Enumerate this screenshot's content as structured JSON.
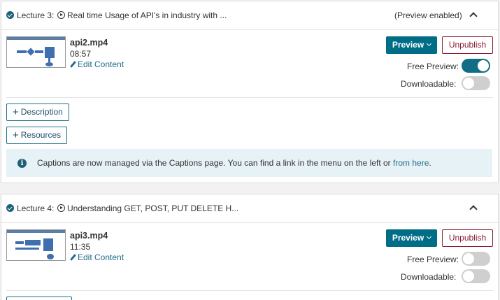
{
  "lectures": [
    {
      "label": "Lecture 3:",
      "title": "Real time Usage of API's in industry with ...",
      "status": "(Preview enabled)",
      "file": "api2.mp4",
      "duration": "08:57",
      "edit_label": "Edit Content",
      "preview_label": "Preview",
      "unpublish_label": "Unpublish",
      "free_preview_label": "Free Preview:",
      "free_preview_on": true,
      "downloadable_label": "Downloadable:",
      "downloadable_on": false,
      "description_label": "Description",
      "resources_label": "Resources",
      "info_text": "Captions are now managed via the Captions page. You can find a link in the menu on the left or ",
      "info_link": "from here",
      "info_end": "."
    },
    {
      "label": "Lecture 4:",
      "title": "Understanding GET, POST, PUT DELETE H...",
      "status": "",
      "file": "api3.mp4",
      "duration": "11:35",
      "edit_label": "Edit Content",
      "preview_label": "Preview",
      "unpublish_label": "Unpublish",
      "free_preview_label": "Free Preview:",
      "free_preview_on": false,
      "downloadable_label": "Downloadable:",
      "downloadable_on": false
    }
  ],
  "icons": {
    "check": "check-circle-icon",
    "play": "play-circle-icon",
    "chevron": "chevron-up-icon",
    "pencil": "pencil-icon",
    "plus": "plus-icon",
    "info": "info-icon",
    "caret": "caret-down-icon"
  },
  "colors": {
    "primary": "#006d86",
    "danger": "#8b1e36",
    "info_bg": "#e7f2f6",
    "toggle_on": "#0f6e85",
    "toggle_off": "#cfcfcf"
  }
}
